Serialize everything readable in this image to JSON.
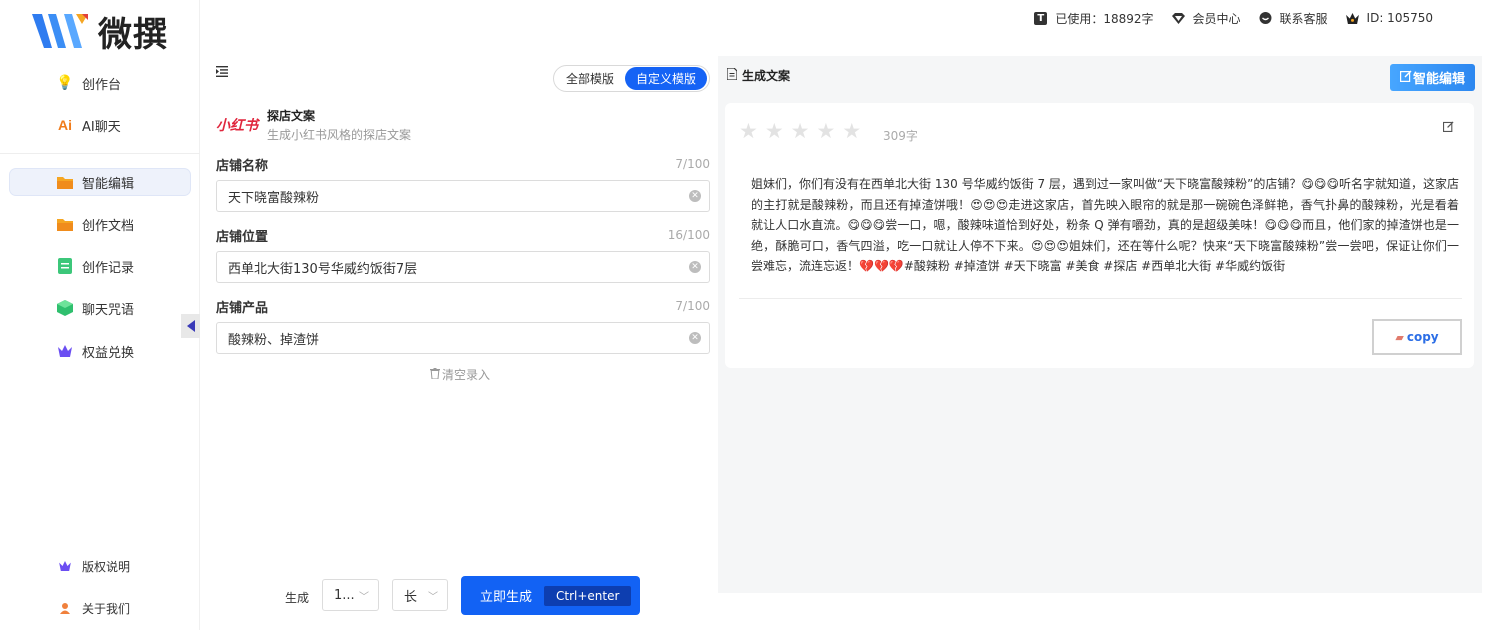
{
  "brand": {
    "name": "微撰"
  },
  "header": {
    "used": "已使用：18892字",
    "member": "会员中心",
    "support": "联系客服",
    "user_id": "ID: 105750"
  },
  "sidebar": {
    "items": [
      {
        "label": "创作台",
        "icon": "bulb-icon",
        "active": false
      },
      {
        "label": "AI聊天",
        "icon": "ai-icon",
        "active": false
      },
      {
        "label": "智能编辑",
        "icon": "folder-icon",
        "active": true
      },
      {
        "label": "创作文档",
        "icon": "folder-icon",
        "active": false
      },
      {
        "label": "创作记录",
        "icon": "document-icon",
        "active": false
      },
      {
        "label": "聊天咒语",
        "icon": "cube-icon",
        "active": false
      },
      {
        "label": "权益兑换",
        "icon": "crown-icon",
        "active": false
      }
    ],
    "bottom_items": [
      {
        "label": "版权说明",
        "icon": "crown-icon"
      },
      {
        "label": "关于我们",
        "icon": "user-icon"
      }
    ]
  },
  "form": {
    "mode_all": "全部模版",
    "mode_custom": "自定义模版",
    "template_logo": "小红书",
    "template_title": "探店文案",
    "template_desc": "生成小红书风格的探店文案",
    "fields": [
      {
        "label": "店铺名称",
        "count": "7/100",
        "value": "天下晓富酸辣粉"
      },
      {
        "label": "店铺位置",
        "count": "16/100",
        "value": "西单北大街130号华威约饭街7层"
      },
      {
        "label": "店铺产品",
        "count": "7/100",
        "value": "酸辣粉、掉渣饼"
      }
    ],
    "clear_label": "清空录入",
    "generate_label": "生成",
    "quantity_value": "1...",
    "length_value": "长",
    "generate_button": "立即生成",
    "shortcut": "Ctrl+enter"
  },
  "output": {
    "title": "生成文案",
    "smart_edit": "智能编辑",
    "word_count": "309字",
    "text": "姐妹们，你们有没有在西单北大街 130 号华威约饭街 7 层，遇到过一家叫做“天下晓富酸辣粉”的店铺？😋😋😋听名字就知道，这家店的主打就是酸辣粉，而且还有掉渣饼哦！😍😍😍走进这家店，首先映入眼帘的就是那一碗碗色泽鲜艳，香气扑鼻的酸辣粉，光是看着就让人口水直流。😋😋😋尝一口，嗯，酸辣味道恰到好处，粉条 Q 弹有嚼劲，真的是超级美味！😋😋😋而且，他们家的掉渣饼也是一绝，酥脆可口，香气四溢，吃一口就让人停不下来。😍😍😍姐妹们，还在等什么呢？快来“天下晓富酸辣粉”尝一尝吧，保证让你们一尝难忘，流连忘返！💔💔💔#酸辣粉 #掉渣饼 #天下晓富 #美食 #探店 #西单北大街 #华威约饭街",
    "copy": "copy",
    "rating": 0
  },
  "colors": {
    "primary": "#1262f4",
    "accent_gradient_start": "#47a6ff",
    "brand_red": "#e0263d"
  }
}
